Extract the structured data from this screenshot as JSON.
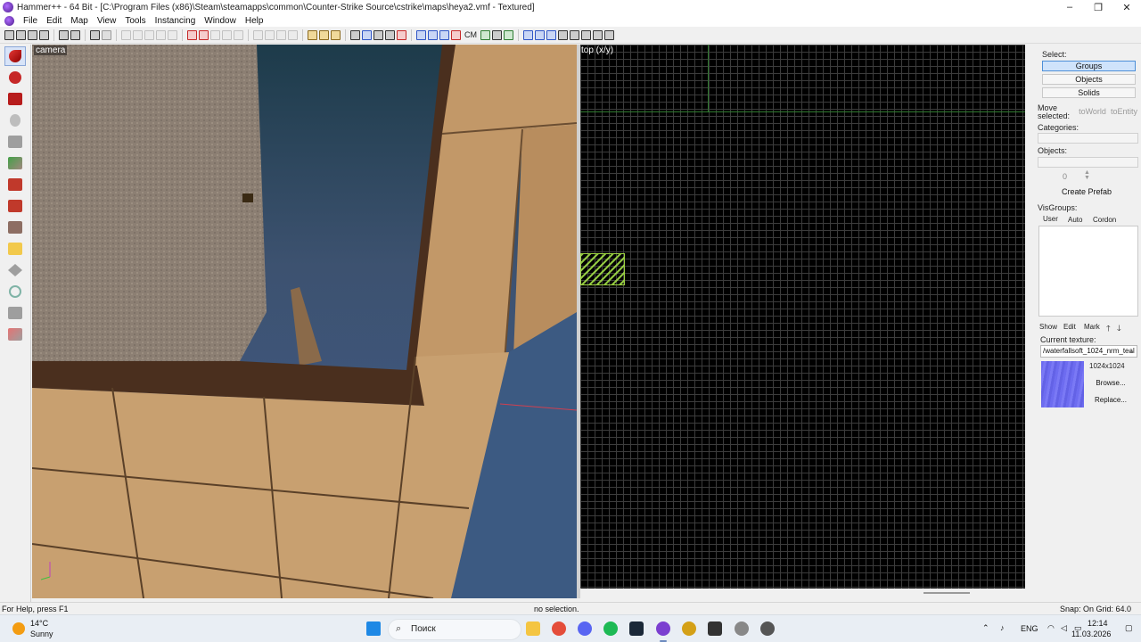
{
  "window": {
    "title": "Hammer++ - 64 Bit - [C:\\Program Files (x86)\\Steam\\steamapps\\common\\Counter-Strike Source\\cstrike\\maps\\heya2.vmf - Textured]",
    "controls": [
      "–",
      "❐",
      "✕"
    ]
  },
  "menu": [
    "File",
    "Edit",
    "Map",
    "View",
    "Tools",
    "Instancing",
    "Window",
    "Help"
  ],
  "toolbar": {
    "cm_label": "CM"
  },
  "viewports": {
    "camera_label": "camera",
    "top_label": "top (x/y)"
  },
  "rightpanel": {
    "select_label": "Select:",
    "select_options": [
      "Groups",
      "Objects",
      "Solids"
    ],
    "selected_option": "Groups",
    "move_selected_label": "Move selected:",
    "to_world": "toWorld",
    "to_entity": "toEntity",
    "categories_label": "Categories:",
    "objects_label": "Objects:",
    "objects_count": "0",
    "create_prefab": "Create Prefab",
    "visgroups_label": "VisGroups:",
    "visgroup_tabs": [
      "User",
      "Auto",
      "Cordon"
    ],
    "visgroup_buttons": [
      "Show",
      "Edit",
      "Mark"
    ],
    "current_texture_label": "Current texture:",
    "current_texture": "/waterfallsoft_1024_nrm_teal",
    "texture_size": "1024x1024",
    "browse": "Browse...",
    "replace": "Replace..."
  },
  "status": {
    "help": "For Help, press F1",
    "selection": "no selection.",
    "snap": "Snap: On Grid: 64.0"
  },
  "taskbar": {
    "weather_temp": "14°C",
    "weather_desc": "Sunny",
    "search_placeholder": "Поиск",
    "language": "ENG",
    "time": "12:14",
    "date": "11.03.2026"
  },
  "colors": {
    "texture_preview": "#7372f2",
    "grid_background": "#000000",
    "selection_hatch": "#a0dc46"
  }
}
